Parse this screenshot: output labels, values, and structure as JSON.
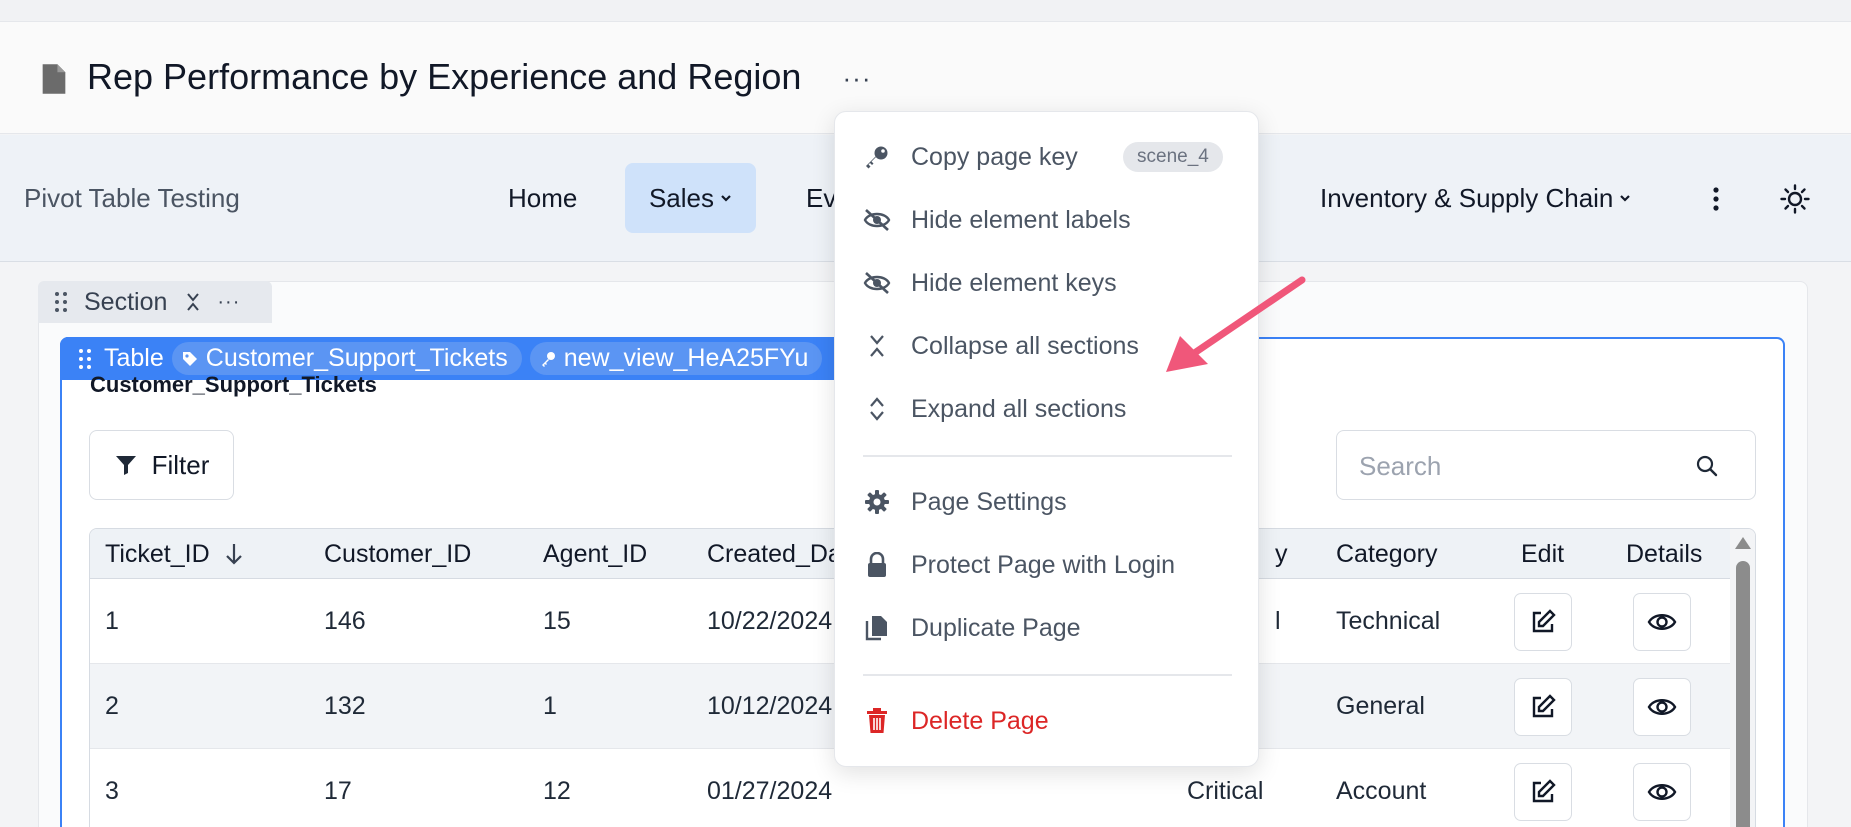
{
  "page": {
    "title": "Rep Performance by Experience and Region",
    "more_label": "···"
  },
  "nav": {
    "app_name": "Pivot Table Testing",
    "items": [
      {
        "label": "Home"
      },
      {
        "label": "Sales"
      },
      {
        "label": "Ev"
      },
      {
        "label": "Inventory & Supply Chain"
      }
    ]
  },
  "section": {
    "label": "Section",
    "dots": "···"
  },
  "table_block": {
    "tag_label": "Table",
    "source_pill": "Customer_Support_Tickets",
    "view_pill": "new_view_HeA25FYu",
    "table_name": "Customer_Support_Tickets"
  },
  "toolbar": {
    "filter_label": "Filter",
    "search_placeholder": "Search"
  },
  "grid": {
    "columns": [
      "Ticket_ID",
      "Customer_ID",
      "Agent_ID",
      "Created_Da",
      "y",
      "Category",
      "Edit",
      "Details"
    ],
    "sort_column": "Ticket_ID",
    "sort_direction": "descending",
    "rows": [
      {
        "ticket_id": "1",
        "customer_id": "146",
        "agent_id": "15",
        "created": "10/22/2024",
        "priority": "l",
        "category": "Technical"
      },
      {
        "ticket_id": "2",
        "customer_id": "132",
        "agent_id": "1",
        "created": "10/12/2024",
        "priority": "",
        "category": "General"
      },
      {
        "ticket_id": "3",
        "customer_id": "17",
        "agent_id": "12",
        "created": "01/27/2024",
        "priority": "Critical",
        "category": "Account"
      }
    ]
  },
  "menu": {
    "items": [
      {
        "label": "Copy page key",
        "icon": "key-icon",
        "badge": "scene_4"
      },
      {
        "label": "Hide element labels",
        "icon": "eye-slash-icon"
      },
      {
        "label": "Hide element keys",
        "icon": "eye-slash-icon"
      },
      {
        "label": "Collapse all sections",
        "icon": "collapse-icon"
      },
      {
        "label": "Expand all sections",
        "icon": "expand-icon"
      },
      {
        "label": "Page Settings",
        "icon": "gear-icon"
      },
      {
        "label": "Protect Page with Login",
        "icon": "lock-icon"
      },
      {
        "label": "Duplicate Page",
        "icon": "copy-icon"
      },
      {
        "label": "Delete Page",
        "icon": "trash-icon"
      }
    ]
  },
  "colors": {
    "accent": "#3b82f6",
    "nav_active": "#cfe2fa",
    "danger": "#dc2626",
    "annotation_arrow": "#f0577a"
  }
}
